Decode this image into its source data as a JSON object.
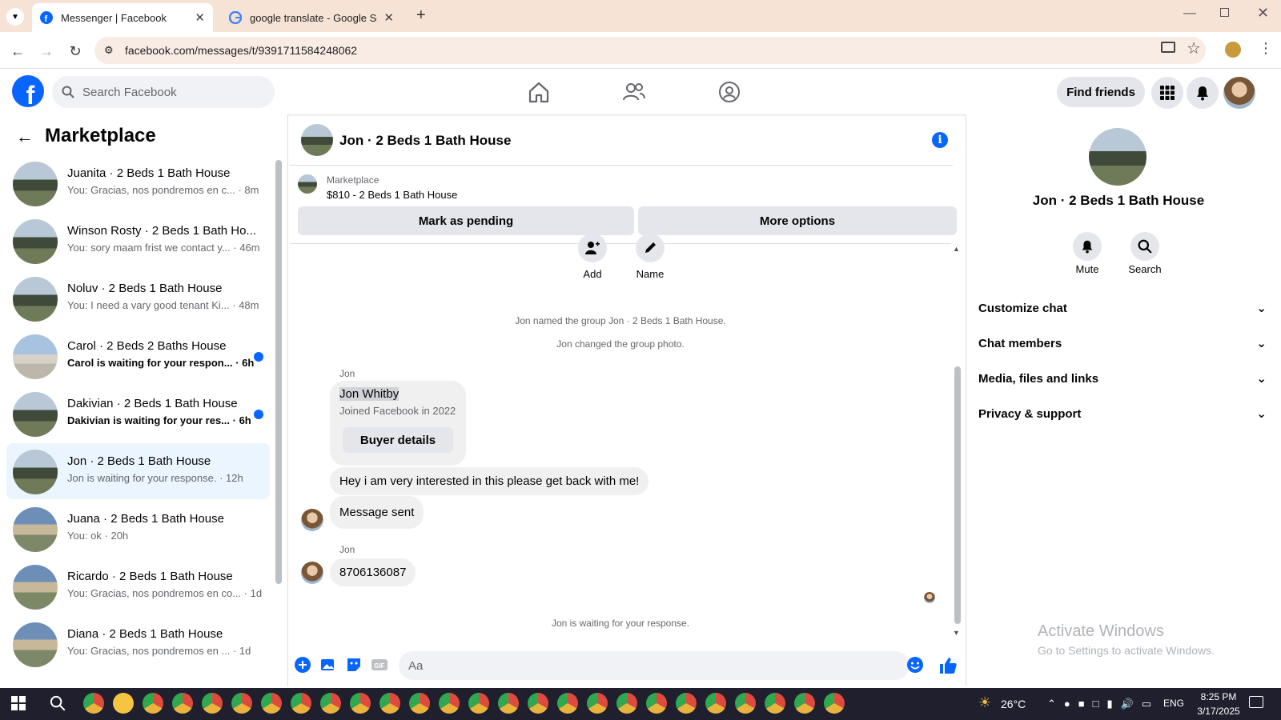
{
  "browser": {
    "tabs": [
      {
        "title": "Messenger | Facebook",
        "active": true,
        "icon": "facebook-icon"
      },
      {
        "title": "google translate - Google Searc",
        "active": false,
        "icon": "google-icon"
      }
    ],
    "url": "facebook.com/messages/t/9391711584248062"
  },
  "fb": {
    "search_placeholder": "Search Facebook",
    "find_friends": "Find friends"
  },
  "sidebar": {
    "title": "Marketplace",
    "conversations": [
      {
        "name": "Juanita · 2 Beds 1 Bath House",
        "preview": "You: Gracias, nos pondremos en c...",
        "time": "· 8m",
        "unread": false,
        "thumb": "house"
      },
      {
        "name": "Winson Rosty · 2 Beds 1 Bath Ho...",
        "preview": "You: sory maam frist we contact y...",
        "time": "· 46m",
        "unread": false,
        "thumb": "house"
      },
      {
        "name": "Noluv · 2 Beds 1 Bath House",
        "preview": "You: I need a vary good tenant Ki...",
        "time": "· 48m",
        "unread": false,
        "thumb": "house"
      },
      {
        "name": "Carol · 2 Beds 2 Baths House",
        "preview": "Carol is waiting for your respon...",
        "time": "· 6h",
        "unread": true,
        "thumb": "house3"
      },
      {
        "name": "Dakivian · 2 Beds 1 Bath House",
        "preview": "Dakivian is waiting for your res...",
        "time": "· 6h",
        "unread": true,
        "thumb": "house"
      },
      {
        "name": "Jon · 2 Beds 1 Bath House",
        "preview": "Jon is waiting for your response.",
        "time": "· 12h",
        "unread": false,
        "selected": true,
        "thumb": "house"
      },
      {
        "name": "Juana · 2 Beds 1 Bath House",
        "preview": "You: ok",
        "time": "· 20h",
        "unread": false,
        "thumb": "house2"
      },
      {
        "name": "Ricardo · 2 Beds 1 Bath House",
        "preview": "You: Gracias, nos pondremos en co...",
        "time": "· 1d",
        "unread": false,
        "thumb": "house2"
      },
      {
        "name": "Diana · 2 Beds 1 Bath House",
        "preview": "You: Gracias, nos pondremos en ...",
        "time": "· 1d",
        "unread": false,
        "thumb": "house2"
      }
    ]
  },
  "chat": {
    "title": "Jon · 2 Beds 1 Bath House",
    "marketplace_label": "Marketplace",
    "listing": "$810 - 2 Beds 1 Bath House",
    "mark_pending": "Mark as pending",
    "more_options": "More options",
    "actions": [
      {
        "label": "Add"
      },
      {
        "label": "Name"
      }
    ],
    "system1": "Jon named the group Jon · 2 Beds 1 Bath House.",
    "system2": "Jon changed the group photo.",
    "sender": "Jon",
    "card_name": "Jon Whitby",
    "card_joined": "Joined Facebook in 2022",
    "buyer_details": "Buyer details",
    "msg1": "Hey i am very interested in this please get back with me!",
    "msg2": "Message sent",
    "msg3": "8706136087",
    "waiting": "Jon is waiting for your response.",
    "input_placeholder": "Aa"
  },
  "details": {
    "name": "Jon · 2 Beds 1 Bath House",
    "mute": "Mute",
    "search": "Search",
    "rows": [
      "Customize chat",
      "Chat members",
      "Media, files and links",
      "Privacy & support"
    ]
  },
  "watermark": {
    "line1": "Activate Windows",
    "line2": "Go to Settings to activate Windows."
  },
  "taskbar": {
    "weather": "26°C",
    "lang": "ENG",
    "time": "8:25 PM",
    "date": "3/17/2025"
  }
}
